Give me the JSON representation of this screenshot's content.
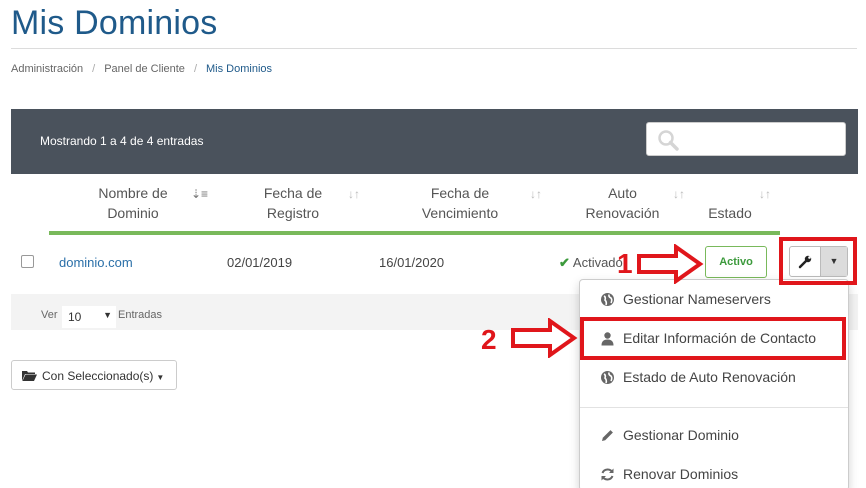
{
  "page": {
    "title": "Mis Dominios"
  },
  "breadcrumb": {
    "items": [
      "Administración",
      "Panel de Cliente",
      "Mis Dominios"
    ],
    "separator": "/"
  },
  "table": {
    "info": "Mostrando 1 a 4 de 4 entradas",
    "search": {
      "value": "",
      "placeholder": ""
    },
    "columns": [
      {
        "label": "Nombre de Dominio",
        "sort": "sorted-asc"
      },
      {
        "label": "Fecha de Registro",
        "sort": "sortable"
      },
      {
        "label": "Fecha de Vencimiento",
        "sort": "sortable"
      },
      {
        "label": "Auto Renovación",
        "sort": "sortable"
      },
      {
        "label": "Estado",
        "sort": "sortable"
      }
    ],
    "rows": [
      {
        "domain": "dominio.com",
        "registered": "02/01/2019",
        "expires": "16/01/2020",
        "auto_renew": "Activado",
        "status": "Activo"
      }
    ],
    "footer": {
      "show_label": "Ver",
      "length_value": "10",
      "entries_label": "Entradas"
    }
  },
  "bulk_action": {
    "label": "Con Seleccionado(s)"
  },
  "dropdown_menu": {
    "items": [
      {
        "label": "Gestionar Nameservers",
        "icon": "globe-icon"
      },
      {
        "label": "Editar Información de Contacto",
        "icon": "user-icon"
      },
      {
        "label": "Estado de Auto Renovación",
        "icon": "globe-icon"
      },
      {
        "label": "Gestionar Dominio",
        "icon": "pencil-icon"
      },
      {
        "label": "Renovar Dominios",
        "icon": "refresh-icon"
      }
    ]
  },
  "annotations": {
    "step1": "1",
    "step2": "2",
    "color": "#e0161b"
  },
  "colors": {
    "brand_title": "#1f5a8a",
    "header_bar": "#4a525c",
    "accent_green": "#79b95b",
    "link": "#2a6fa8"
  }
}
